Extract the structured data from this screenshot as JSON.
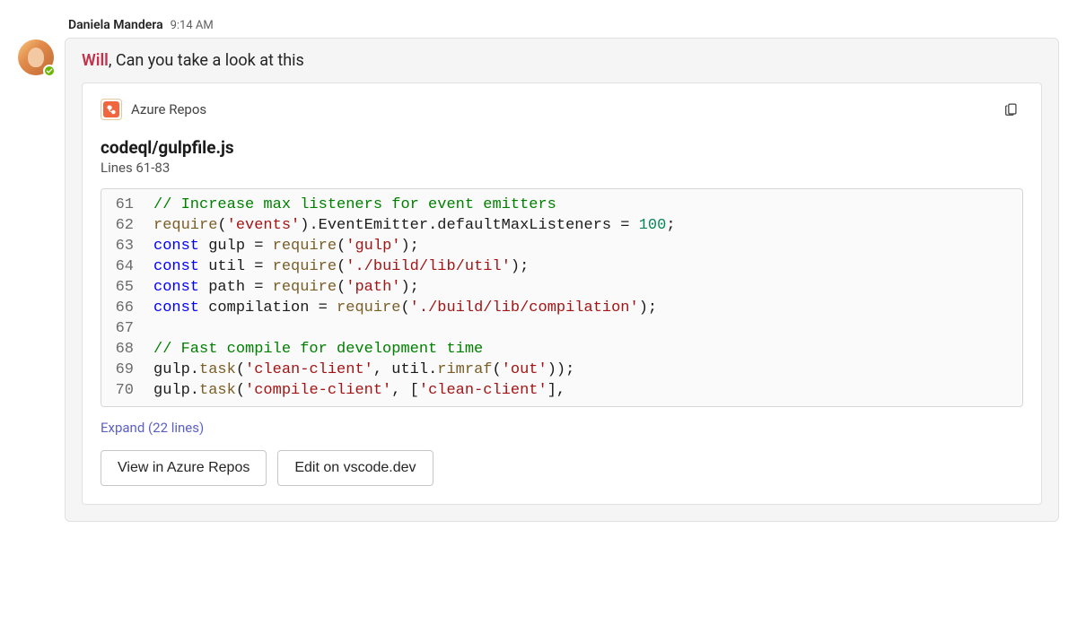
{
  "sender": {
    "name": "Daniela Mandera",
    "time": "9:14 AM"
  },
  "message": {
    "mention": "Will",
    "text": ", Can you take a look at this"
  },
  "card": {
    "app_name": "Azure Repos",
    "file_title": "codeql/gulpfile.js",
    "lines_label": "Lines 61-83",
    "expand_label": "Expand (22 lines)",
    "actions": {
      "view": "View in Azure Repos",
      "edit": "Edit on vscode.dev"
    }
  },
  "code": [
    {
      "n": "61",
      "tokens": [
        {
          "t": "// Increase max listeners for event emitters",
          "c": "comment"
        }
      ]
    },
    {
      "n": "62",
      "tokens": [
        {
          "t": "require",
          "c": "method"
        },
        {
          "t": "("
        },
        {
          "t": "'events'",
          "c": "string"
        },
        {
          "t": ").EventEmitter.defaultMaxListeners = "
        },
        {
          "t": "100",
          "c": "number"
        },
        {
          "t": ";"
        }
      ]
    },
    {
      "n": "63",
      "tokens": [
        {
          "t": "const",
          "c": "keyword"
        },
        {
          "t": " gulp = "
        },
        {
          "t": "require",
          "c": "method"
        },
        {
          "t": "("
        },
        {
          "t": "'gulp'",
          "c": "string"
        },
        {
          "t": ");"
        }
      ]
    },
    {
      "n": "64",
      "tokens": [
        {
          "t": "const",
          "c": "keyword"
        },
        {
          "t": " util = "
        },
        {
          "t": "require",
          "c": "method"
        },
        {
          "t": "("
        },
        {
          "t": "'./build/lib/util'",
          "c": "string"
        },
        {
          "t": ");"
        }
      ]
    },
    {
      "n": "65",
      "tokens": [
        {
          "t": "const",
          "c": "keyword"
        },
        {
          "t": " path = "
        },
        {
          "t": "require",
          "c": "method"
        },
        {
          "t": "("
        },
        {
          "t": "'path'",
          "c": "string"
        },
        {
          "t": ");"
        }
      ]
    },
    {
      "n": "66",
      "tokens": [
        {
          "t": "const",
          "c": "keyword"
        },
        {
          "t": " compilation = "
        },
        {
          "t": "require",
          "c": "method"
        },
        {
          "t": "("
        },
        {
          "t": "'./build/lib/compilation'",
          "c": "string"
        },
        {
          "t": ");"
        }
      ]
    },
    {
      "n": "67",
      "tokens": [
        {
          "t": ""
        }
      ]
    },
    {
      "n": "68",
      "tokens": [
        {
          "t": "// Fast compile for development time",
          "c": "comment"
        }
      ]
    },
    {
      "n": "69",
      "tokens": [
        {
          "t": "gulp."
        },
        {
          "t": "task",
          "c": "method"
        },
        {
          "t": "("
        },
        {
          "t": "'clean-client'",
          "c": "string"
        },
        {
          "t": ", util."
        },
        {
          "t": "rimraf",
          "c": "method"
        },
        {
          "t": "("
        },
        {
          "t": "'out'",
          "c": "string"
        },
        {
          "t": "));"
        }
      ]
    },
    {
      "n": "70",
      "tokens": [
        {
          "t": "gulp."
        },
        {
          "t": "task",
          "c": "method"
        },
        {
          "t": "("
        },
        {
          "t": "'compile-client'",
          "c": "string"
        },
        {
          "t": ", ["
        },
        {
          "t": "'clean-client'",
          "c": "string"
        },
        {
          "t": "],"
        }
      ]
    }
  ]
}
